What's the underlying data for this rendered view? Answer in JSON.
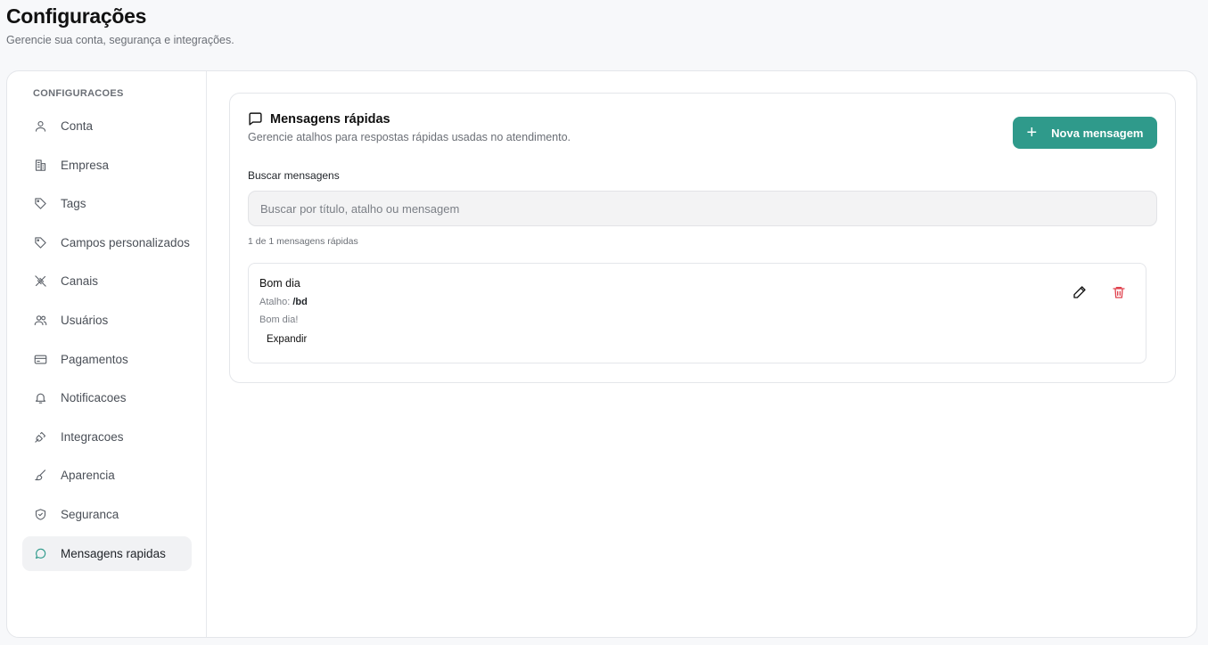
{
  "header": {
    "title": "Configurações",
    "subtitle": "Gerencie sua conta, segurança e integrações."
  },
  "sidebar": {
    "heading": "CONFIGURACOES",
    "items": [
      {
        "label": "Conta",
        "icon": "user-icon"
      },
      {
        "label": "Empresa",
        "icon": "building-icon"
      },
      {
        "label": "Tags",
        "icon": "tag-icon"
      },
      {
        "label": "Campos personalizados",
        "icon": "tag-icon"
      },
      {
        "label": "Canais",
        "icon": "unplug-icon"
      },
      {
        "label": "Usuários",
        "icon": "users-icon"
      },
      {
        "label": "Pagamentos",
        "icon": "credit-card-icon"
      },
      {
        "label": "Notificacoes",
        "icon": "bell-icon"
      },
      {
        "label": "Integracoes",
        "icon": "plug-icon"
      },
      {
        "label": "Aparencia",
        "icon": "brush-icon"
      },
      {
        "label": "Seguranca",
        "icon": "shield-icon"
      },
      {
        "label": "Mensagens rapidas",
        "icon": "message-circle-icon",
        "active": true
      }
    ]
  },
  "quick_messages": {
    "title": "Mensagens rápidas",
    "description": "Gerencie atalhos para respostas rápidas usadas no atendimento.",
    "new_button_label": "Nova mensagem",
    "search_label": "Buscar mensagens",
    "search_placeholder": "Buscar por título, atalho ou mensagem",
    "search_value": "",
    "count_text": "1 de 1 mensagens rápidas",
    "messages": [
      {
        "title": "Bom dia",
        "shortcut_label": "Atalho:",
        "shortcut": "/bd",
        "body": "Bom dia!",
        "expand_label": "Expandir"
      }
    ]
  },
  "colors": {
    "accent": "#2f9a8b",
    "danger": "#e0434f",
    "active_icon": "#2f9a8b"
  }
}
